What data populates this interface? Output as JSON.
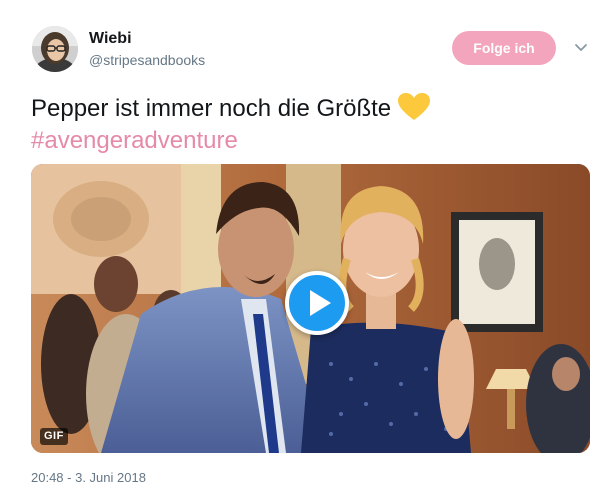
{
  "author": {
    "display_name": "Wiebi",
    "handle": "@stripesandbooks",
    "avatar_icon": "user-avatar"
  },
  "follow_button": {
    "label": "Folge ich",
    "color": "#f2a5bd"
  },
  "menu": {
    "icon": "chevron-down-icon"
  },
  "tweet": {
    "text": "Pepper ist immer noch die Größte",
    "emoji_icon": "yellow-heart-icon",
    "hashtag": "#avengeradventure",
    "hashtag_color": "#e58aa8"
  },
  "media": {
    "badge": "GIF",
    "play_icon": "play-icon",
    "play_color": "#1d9bf0"
  },
  "timestamp": "20:48 - 3. Juni 2018"
}
